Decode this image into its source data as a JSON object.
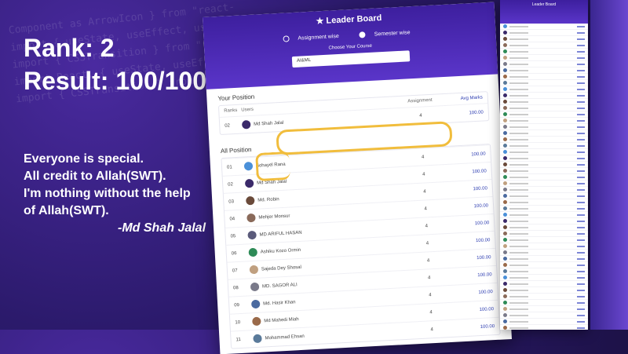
{
  "background_code": [
    "Component as ArrowIcon } from \"react-",
    "import { useState, useEffect, use",
    "import { CSSTransition } from \"react-tr",
    "import React, { useState, useEffect",
    "import { CSSTransition } from \"react-"
  ],
  "headline": {
    "rank": "Rank: 2",
    "result": "Result: 100/100"
  },
  "quote": {
    "line1": "Everyone is special.",
    "line2": "All credit to Allah(SWT).",
    "line3": "I'm nothing without the help",
    "line4": "of Allah(SWT).",
    "author": "-Md Shah Jalal"
  },
  "leaderboard": {
    "title": "Leader Board",
    "radio_assignment": "Assignment wise",
    "radio_semester": "Semester wise",
    "choose_label": "Choose Your Course",
    "course_value": "AI&ML",
    "your_position_title": "Your Position",
    "headers": {
      "ranks": "Ranks",
      "users": "Users",
      "assignment": "Assignment",
      "marks": "Avg Marks"
    },
    "your_row": {
      "rank": "02",
      "name": "Md Shah Jalal",
      "assignment": "4",
      "marks": "100.00"
    },
    "all_position_title": "All Position",
    "rows": [
      {
        "rank": "01",
        "name": "Sohayel Rana",
        "assignment": "4",
        "marks": "100.00",
        "color": "#4a90d9"
      },
      {
        "rank": "02",
        "name": "Md Shah Jalal",
        "assignment": "4",
        "marks": "100.00",
        "color": "#3b2a6a"
      },
      {
        "rank": "03",
        "name": "Md. Robin",
        "assignment": "4",
        "marks": "100.00",
        "color": "#6a4a3a"
      },
      {
        "rank": "04",
        "name": "Mehjer Monsur",
        "assignment": "4",
        "marks": "100.00",
        "color": "#8a6a5a"
      },
      {
        "rank": "05",
        "name": "MD ARIFUL HASAN",
        "assignment": "4",
        "marks": "100.00",
        "color": "#5a5a7a"
      },
      {
        "rank": "06",
        "name": "Ashiku Kozo Ormin",
        "assignment": "4",
        "marks": "100.00",
        "color": "#2e8b57"
      },
      {
        "rank": "07",
        "name": "Sajeda Dey Shosal",
        "assignment": "4",
        "marks": "100.00",
        "color": "#c0a080"
      },
      {
        "rank": "08",
        "name": "MD. SAGOR ALI",
        "assignment": "4",
        "marks": "100.00",
        "color": "#7a7a8a"
      },
      {
        "rank": "09",
        "name": "Md. Hasir Khan",
        "assignment": "4",
        "marks": "100.00",
        "color": "#4a6aa0"
      },
      {
        "rank": "10",
        "name": "Md Mahedi Miah",
        "assignment": "4",
        "marks": "100.00",
        "color": "#9a6a4a"
      },
      {
        "rank": "11",
        "name": "Mohammad Ehsan",
        "assignment": "4",
        "marks": "100.00",
        "color": "#5a7a9a"
      }
    ]
  },
  "tall_list": {
    "title": "Leader Board",
    "row_colors": [
      "#4a90d9",
      "#3b2a6a",
      "#6a4a3a",
      "#8a6a5a",
      "#2e8b57",
      "#c0a080",
      "#7a7a8a",
      "#4a6aa0",
      "#9a6a4a",
      "#5a7a9a"
    ]
  }
}
